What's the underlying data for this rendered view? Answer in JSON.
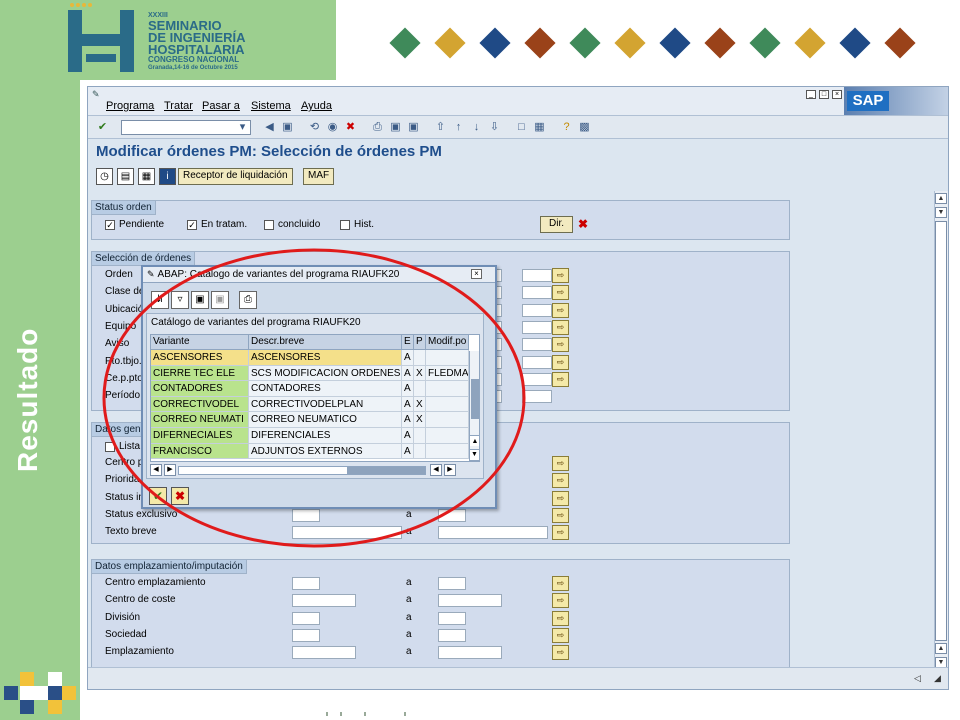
{
  "slide": {
    "side_title": "Resultado",
    "logo": {
      "line1": "XXXIII",
      "line2": "SEMINARIO",
      "line3": "DE INGENIERÍA",
      "line4": "HOSPITALARIA",
      "line5": "CONGRESO NACIONAL",
      "line6": "Granada,14-16 de Octubre 2015"
    },
    "diamond_colors": [
      "#3f8a5a",
      "#d3a431",
      "#1f4a86",
      "#9a4219",
      "#3f8a5a",
      "#d3a431",
      "#1f4a86",
      "#9a4219",
      "#3f8a5a",
      "#d3a431",
      "#1f4a86",
      "#9a4219"
    ]
  },
  "sap": {
    "menu": [
      "Programa",
      "Tratar",
      "Pasar a",
      "Sistema",
      "Ayuda"
    ],
    "logo_text": "SAP",
    "screen_title": "Modificar órdenes PM: Selección de órdenes PM",
    "app_buttons": {
      "receptor": "Receptor de liquidación",
      "maf": "MAF"
    },
    "status_group": {
      "title": "Status orden",
      "pendiente": "Pendiente",
      "en_tratam": "En tratam.",
      "concluido": "concluido",
      "hist": "Hist.",
      "dir": "Dir."
    },
    "seleccion_group": {
      "title": "Selección de órdenes",
      "labels": [
        "Orden",
        "Clase de",
        "Ubicació",
        "Equipo",
        "Aviso",
        "Pto.tbjo.r",
        "Ce.p.pto",
        "Período"
      ]
    },
    "datos_group": {
      "title": "Datos gen",
      "lista": "Lista",
      "labels": [
        "Centro p",
        "Priorida",
        "Status in",
        "Status exclusivo",
        "Texto breve"
      ],
      "a": "a"
    },
    "emplaz_group": {
      "title": "Datos emplazamiento/imputación",
      "labels": [
        "Centro emplazamiento",
        "Centro de coste",
        "División",
        "Sociedad",
        "Emplazamiento"
      ],
      "a": "a"
    }
  },
  "popup": {
    "title": "ABAP: Catálogo de variantes del programa RIAUFK20",
    "catalog_title": "Catálogo de variantes del programa RIAUFK20",
    "columns": [
      "Variante",
      "Descr.breve",
      "E",
      "P",
      "Modif.po"
    ],
    "rows": [
      [
        "ASCENSORES",
        "ASCENSORES",
        "A",
        "",
        ""
      ],
      [
        "CIERRE TEC ELE",
        "SCS MODIFICACION ORDENES",
        "A",
        "X",
        "FLEDMA"
      ],
      [
        "CONTADORES",
        "CONTADORES",
        "A",
        "",
        ""
      ],
      [
        "CORRECTIVODEL",
        "CORRECTIVODELPLAN",
        "A",
        "X",
        ""
      ],
      [
        "CORREO NEUMATI",
        "CORREO NEUMATICO",
        "A",
        "X",
        ""
      ],
      [
        "DIFERNECIALES",
        "DIFERENCIALES",
        "A",
        "",
        ""
      ],
      [
        "FRANCISCO",
        "ADJUNTOS EXTERNOS",
        "A",
        "",
        ""
      ]
    ]
  }
}
